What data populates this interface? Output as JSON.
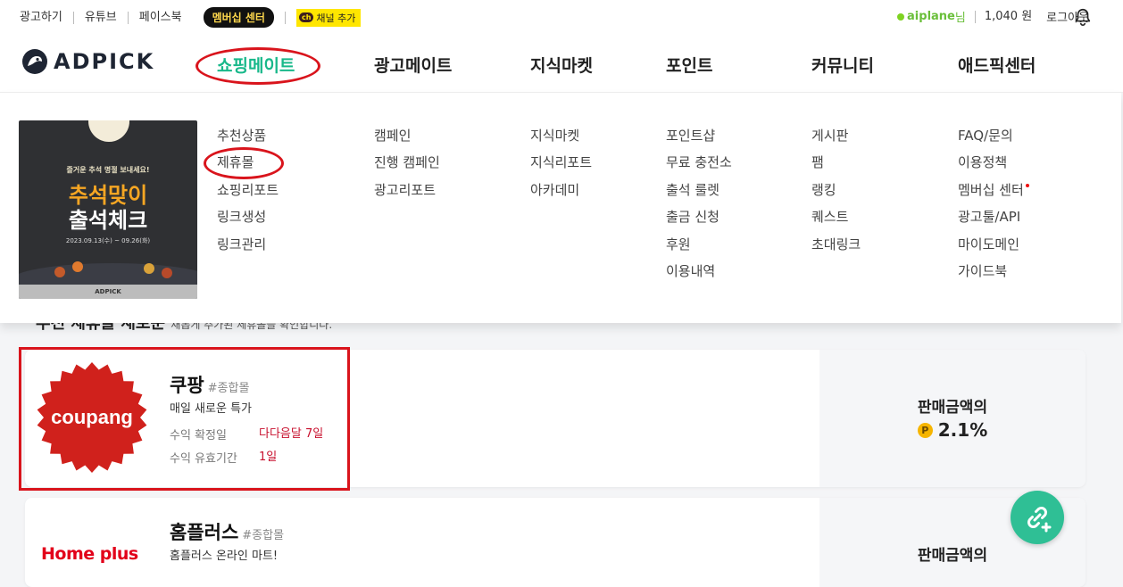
{
  "topbar": {
    "links": [
      "광고하기",
      "유튜브",
      "페이스북"
    ],
    "membership": "멤버십 센터",
    "channel_add": "채널 추가",
    "channel_icon": "ch",
    "username": "aiplane",
    "username_suffix": "님",
    "points": "1,040 원",
    "logout": "로그아웃"
  },
  "header": {
    "logo": "ADPICK",
    "nav": [
      "쇼핑메이트",
      "광고메이트",
      "지식마켓",
      "포인트",
      "커뮤니티",
      "애드픽센터"
    ]
  },
  "banner": {
    "subtitle": "즐거운 추석 명절 보내세요!",
    "title1": "추석맞이",
    "title2": "출석체크",
    "date": "2023.09.13(수) ~ 09.26(화)",
    "footer": "ADPICK"
  },
  "menu": {
    "shopping": [
      "추천상품",
      "제휴몰",
      "쇼핑리포트",
      "링크생성",
      "링크관리"
    ],
    "ad": [
      "캠페인",
      "진행 캠페인",
      "광고리포트"
    ],
    "knowledge": [
      "지식마켓",
      "지식리포트",
      "아카데미"
    ],
    "point": [
      "포인트샵",
      "무료 충전소",
      "출석 룰렛",
      "출금 신청",
      "후원",
      "이용내역"
    ],
    "community": [
      "게시판",
      "팸",
      "랭킹",
      "퀘스트",
      "초대링크"
    ],
    "center": [
      "FAQ/문의",
      "이용정책",
      "멤버십 센터",
      "광고툴/API",
      "마이도메인",
      "가이드북"
    ]
  },
  "behind": {
    "title": "추천 제휴몰 새로운",
    "desc": "새롭게 추가된 제휴몰을 확인합니다."
  },
  "cards": [
    {
      "name": "쿠팡",
      "tag": "#종합몰",
      "desc": "매일 새로운 특가",
      "confirm_label": "수익 확정일",
      "confirm_value": "다다음달 7일",
      "valid_label": "수익 유효기간",
      "valid_value": "1일",
      "logo_text": "coupang",
      "rate_label": "판매금액의",
      "rate": "2.1%",
      "coin": "P"
    },
    {
      "name": "홈플러스",
      "tag": "#종합몰",
      "desc": "홈플러스 온라인 마트!",
      "logo_text": "Home plus",
      "rate_label": "판매금액의"
    }
  ],
  "colors": {
    "accent": "#18b88a",
    "highlight": "#d9141c",
    "fab": "#2fbf95"
  }
}
